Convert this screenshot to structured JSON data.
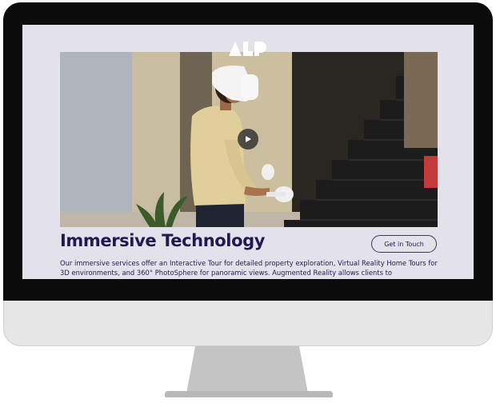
{
  "page": {
    "logo_text": "ALP",
    "hero": {
      "play_icon": "play-icon"
    },
    "title": "Immersive Technology",
    "cta_label": "Get in Touch",
    "description": "Our immersive services offer an Interactive Tour for detailed property exploration, Virtual Reality Home Tours for 3D environments, and 360° PhotoSphere for panoramic views. Augmented Reality allows clients to"
  },
  "colors": {
    "title": "#1f1b52",
    "screen_bg": "#e3e1ea",
    "bezel": "#0b0b0b",
    "monitor_body": "#e6e6e6",
    "stand": "#b8b8b8"
  }
}
